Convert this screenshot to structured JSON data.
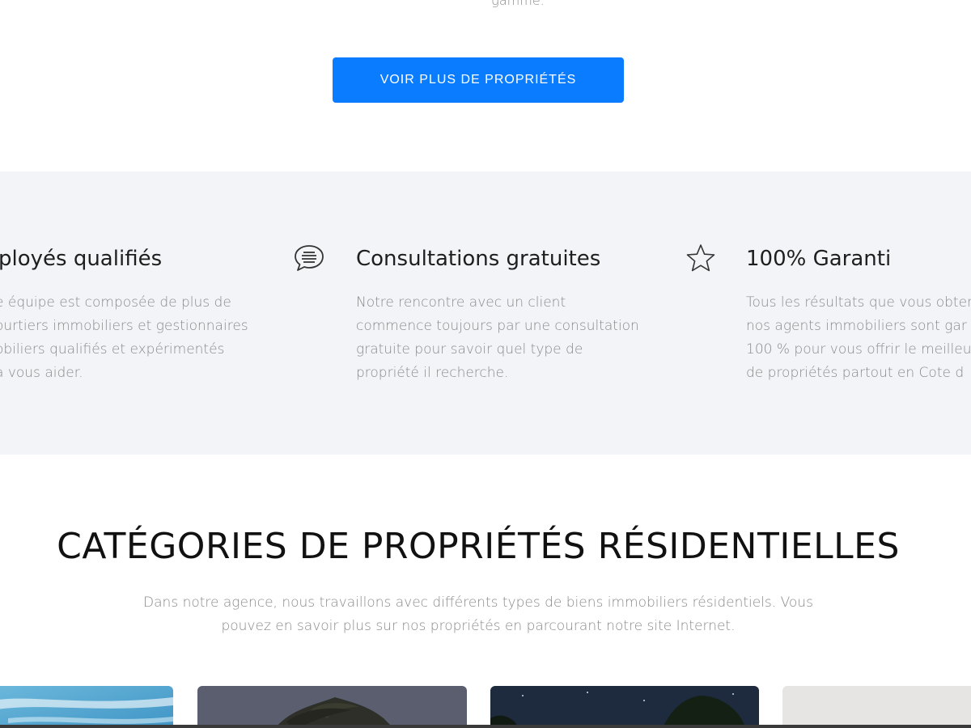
{
  "top_text": "gamme.",
  "cta": {
    "label": "VOIR PLUS DE PROPRIÉTÉS"
  },
  "features": [
    {
      "icon": "users-icon",
      "title": "ployés qualifiés",
      "lines": [
        "e équipe est composée de plus de",
        "ourtiers immobiliers et gestionnaires",
        "obiliers qualifiés et expérimentés",
        " à vous aider."
      ]
    },
    {
      "icon": "chat-bubble-icon",
      "title": "Consultations gratuites",
      "lines": [
        "Notre rencontre avec un client",
        "commence toujours par une consultation",
        "gratuite pour savoir quel type de",
        "propriété il recherche."
      ]
    },
    {
      "icon": "star-icon",
      "title": "100% Garanti",
      "lines": [
        "Tous les résultats que vous obter",
        "nos agents immobiliers sont gar",
        "100 % pour vous offrir le meilleu",
        "de propriétés partout en Cote d"
      ]
    }
  ],
  "categories": {
    "title": "CATÉGORIES DE PROPRIÉTÉS RÉSIDENTIELLES",
    "subtitle_lines": [
      "Dans notre agence, nous travaillons avec différents types de biens immobiliers résidentiels. Vous",
      "pouvez en savoir plus sur nos propriétés en parcourant notre site Internet."
    ]
  },
  "colors": {
    "accent": "#0a7cff",
    "features_bg": "#f3f4f8"
  }
}
